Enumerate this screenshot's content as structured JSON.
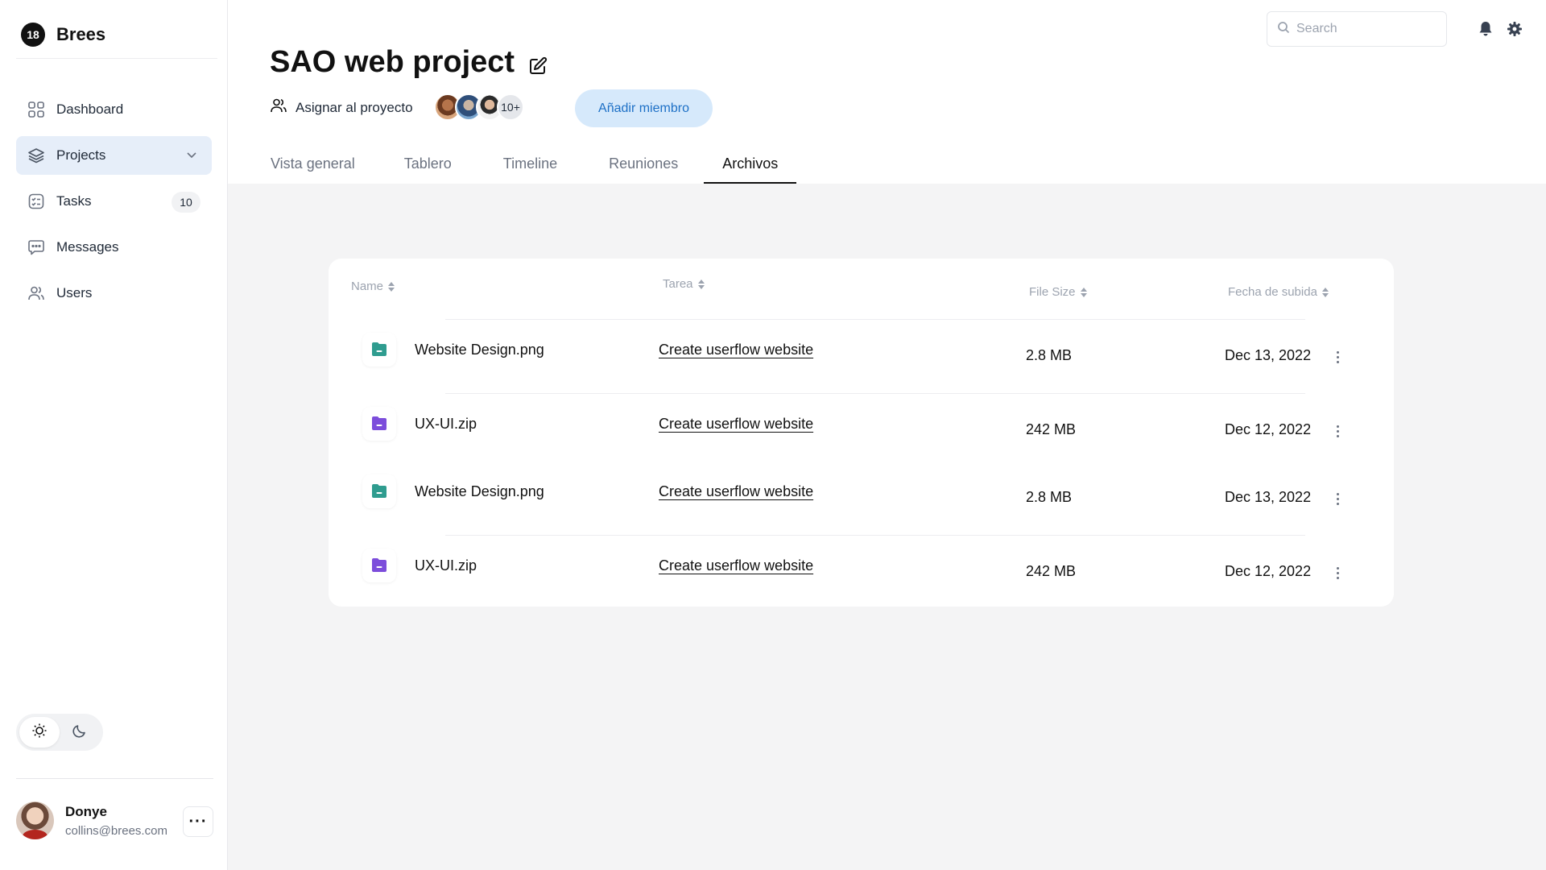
{
  "brand": {
    "logo_text": "18",
    "name": "Brees"
  },
  "sidebar": {
    "items": [
      {
        "label": "Dashboard",
        "icon": "grid-icon"
      },
      {
        "label": "Projects",
        "icon": "layers-icon"
      },
      {
        "label": "Tasks",
        "icon": "checklist-icon",
        "badge": "10"
      },
      {
        "label": "Messages",
        "icon": "chat-icon"
      },
      {
        "label": "Users",
        "icon": "users-icon"
      }
    ],
    "active": "Projects"
  },
  "theme": {
    "options": [
      "light",
      "dark"
    ],
    "selected": "light"
  },
  "user": {
    "name": "Donye",
    "email": "collins@brees.com",
    "more_label": "···"
  },
  "header": {
    "title": "SAO web project",
    "assign_label": "Asignar al proyecto",
    "members_more": "10+",
    "add_member_label": "Añadir miembro",
    "search_placeholder": "Search"
  },
  "tabs": [
    {
      "label": "Vista general"
    },
    {
      "label": "Tablero"
    },
    {
      "label": "Timeline"
    },
    {
      "label": "Reuniones"
    },
    {
      "label": "Archivos"
    }
  ],
  "active_tab": "Archivos",
  "table": {
    "columns": [
      "Name",
      "Tarea",
      "File Size",
      "Fecha de subida"
    ],
    "rows": [
      {
        "name": "Website Design.png",
        "task": "Create userflow website",
        "size": "2.8 MB",
        "date": "Dec 13, 2022",
        "icon_color": "#2f9c8f"
      },
      {
        "name": "UX-UI.zip",
        "task": "Create userflow website",
        "size": "242 MB",
        "date": "Dec 12, 2022",
        "icon_color": "#7c4ddb"
      },
      {
        "name": "Website Design.png",
        "task": "Create userflow website",
        "size": "2.8 MB",
        "date": "Dec 13, 2022",
        "icon_color": "#2f9c8f"
      },
      {
        "name": "UX-UI.zip",
        "task": "Create userflow website",
        "size": "242 MB",
        "date": "Dec 12, 2022",
        "icon_color": "#7c4ddb"
      }
    ]
  },
  "colors": {
    "active_nav_bg": "#e6eef9",
    "button_bg": "#d6e9fb",
    "button_text": "#1d70c6",
    "content_bg": "#f4f4f5"
  }
}
